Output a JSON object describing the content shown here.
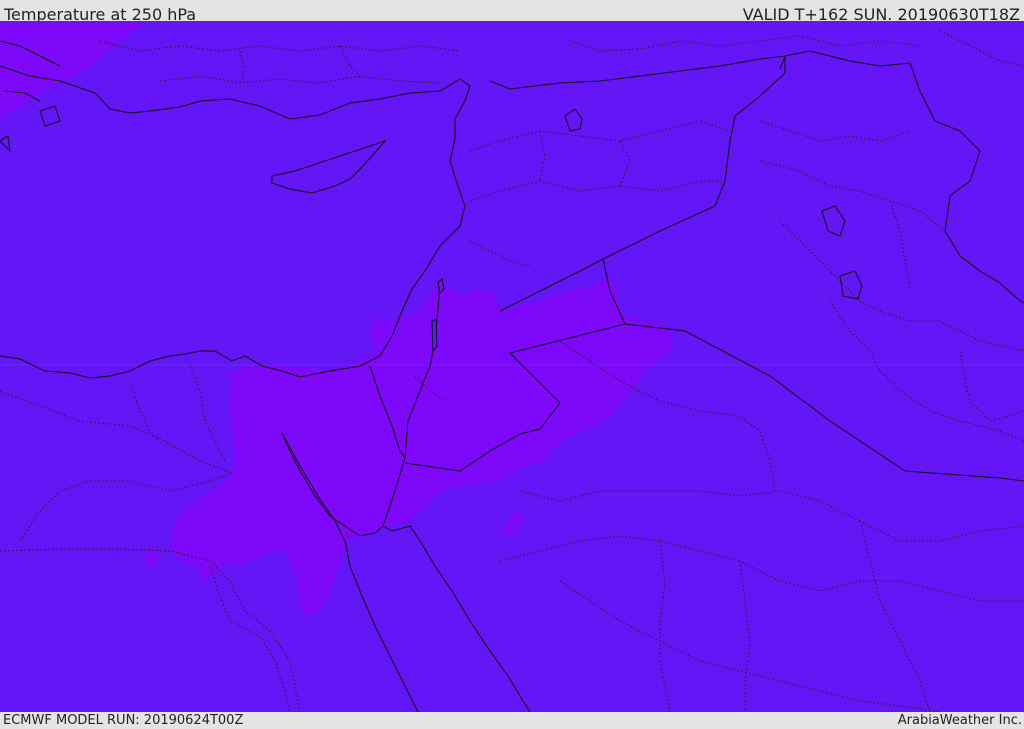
{
  "header": {
    "title": "Temperature at 250 hPa",
    "valid": "VALID T+162 SUN. 20190630T18Z"
  },
  "footer": {
    "model_run": "ECMWF MODEL RUN: 20190624T00Z",
    "credit": "ArabiaWeather Inc."
  },
  "colors": {
    "base_field": "#6416f7",
    "warm_field": "#7e08f9",
    "borders": "#111111"
  }
}
